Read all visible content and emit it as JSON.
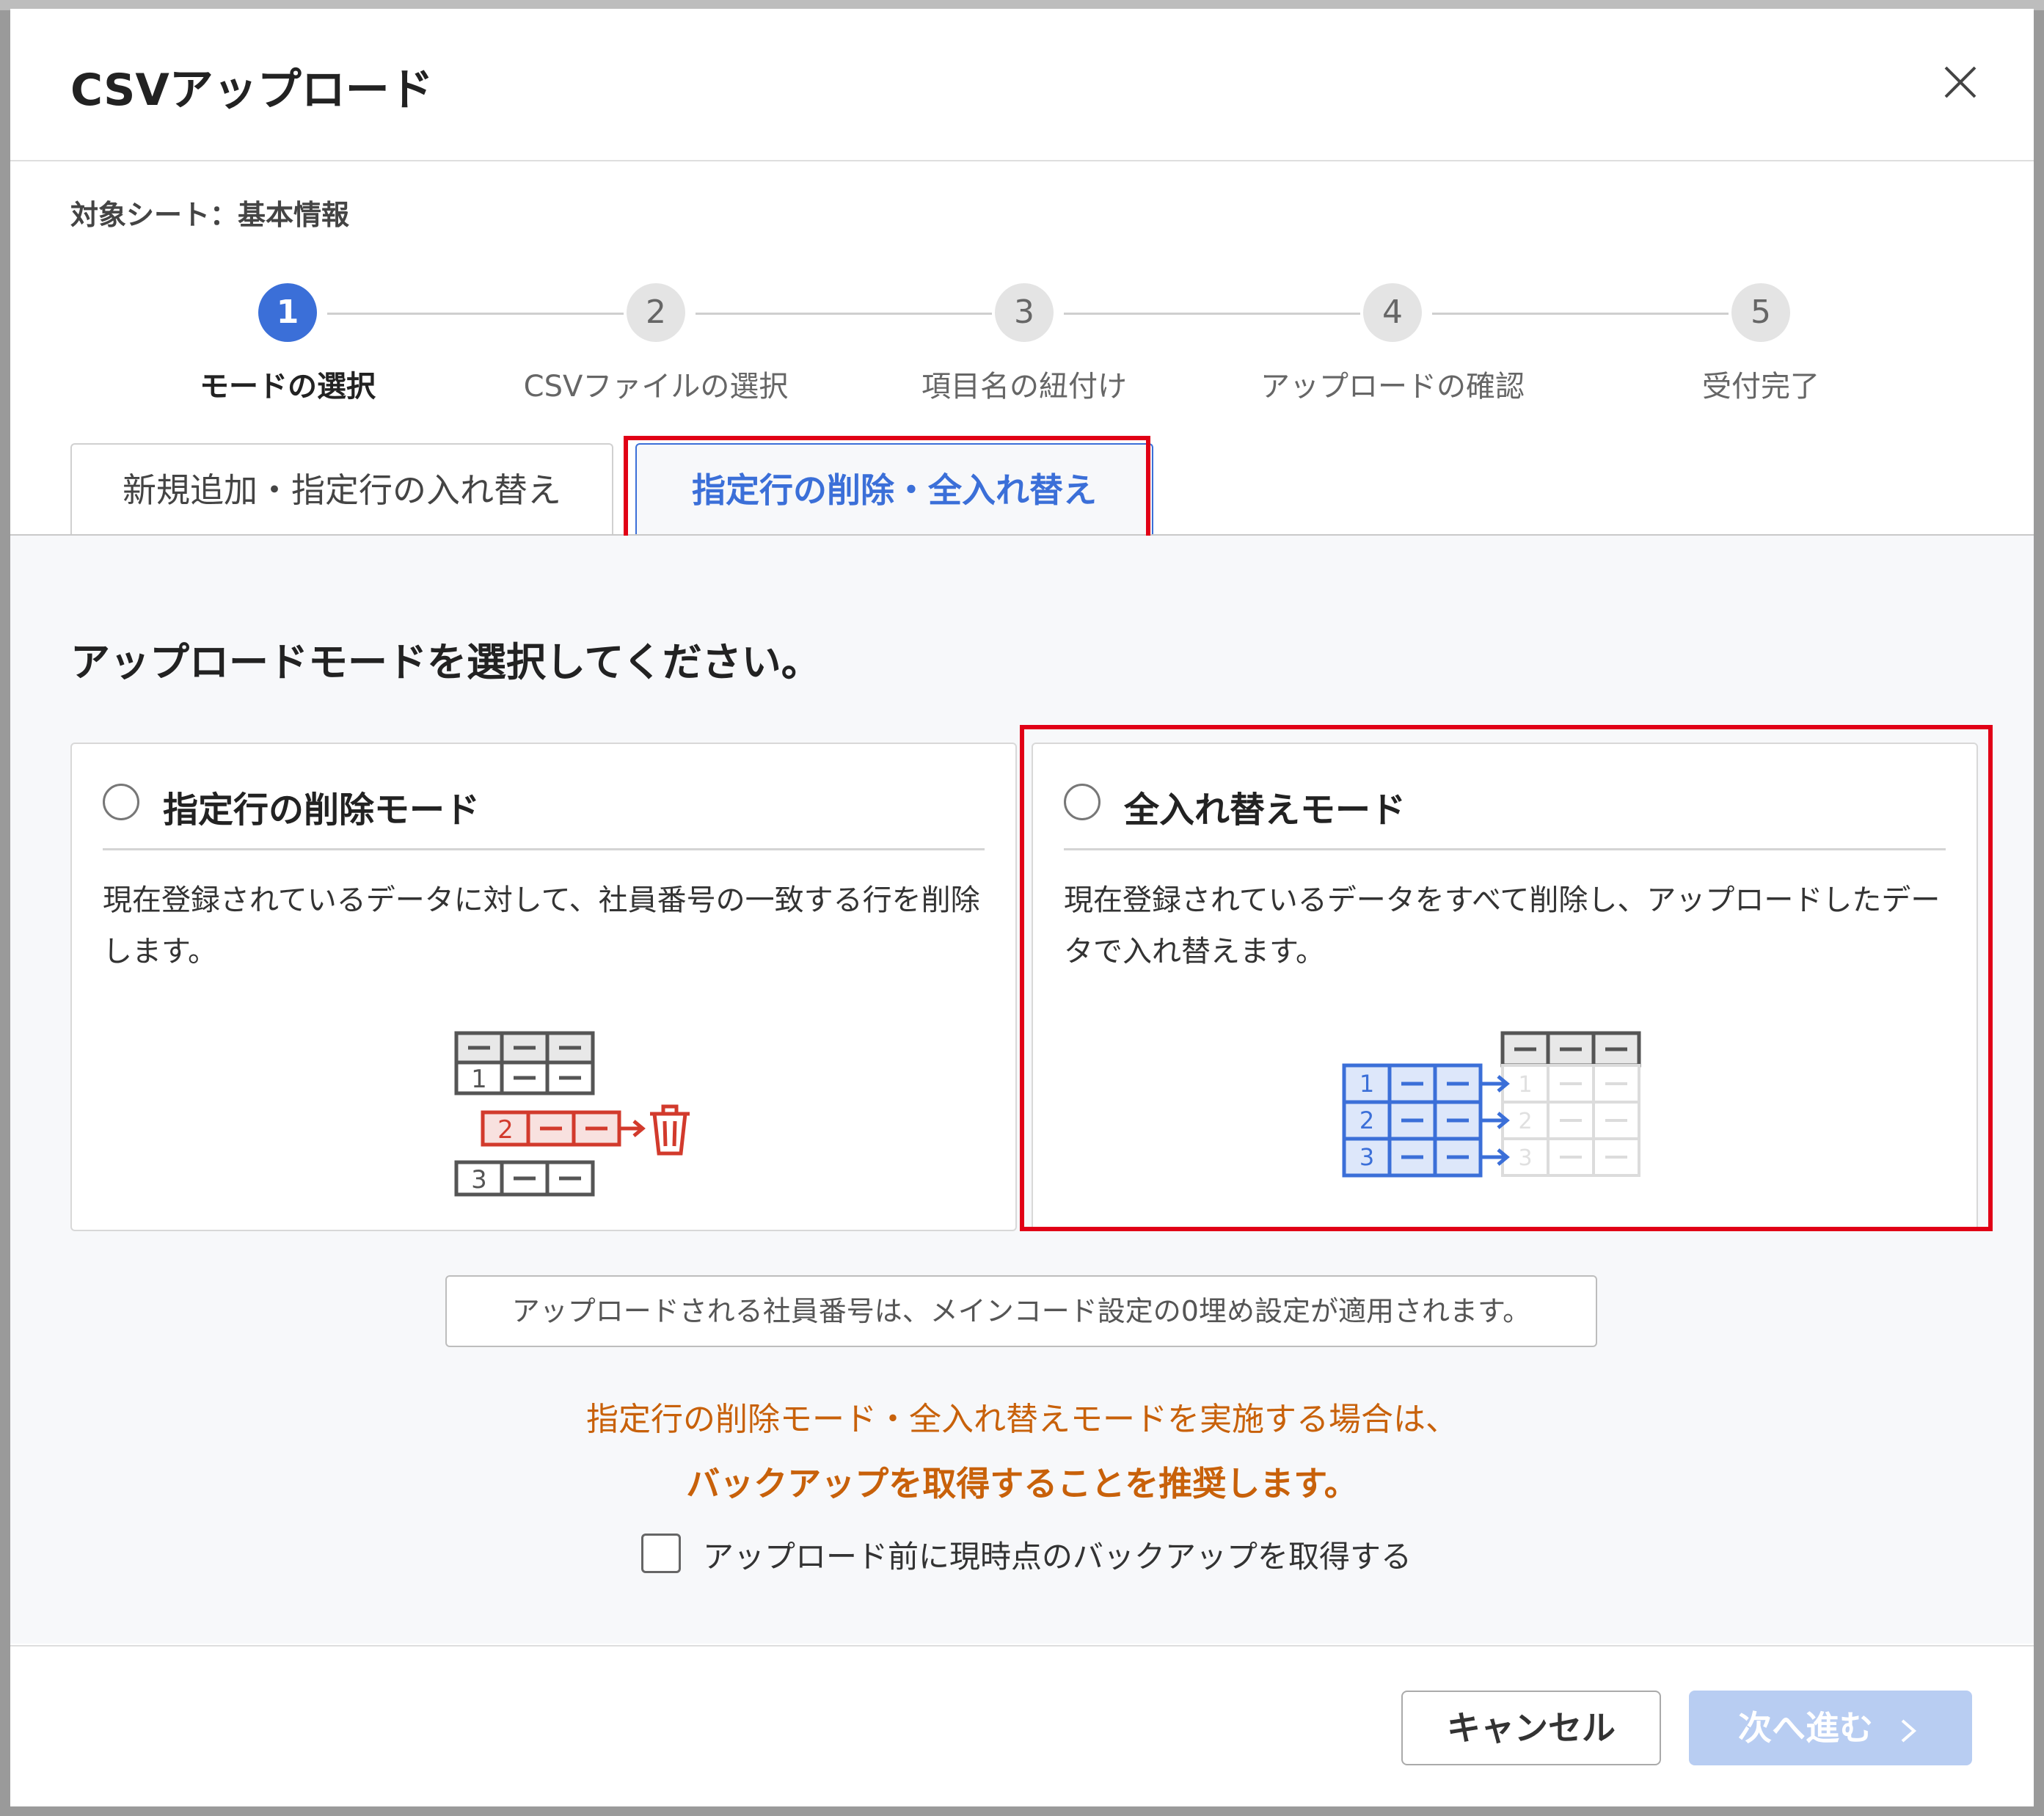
{
  "dialog": {
    "title": "CSVアップロード",
    "target_sheet": "対象シート：基本情報"
  },
  "stepper": [
    {
      "num": "1",
      "label": "モードの選択",
      "active": true
    },
    {
      "num": "2",
      "label": "CSVファイルの選択",
      "active": false
    },
    {
      "num": "3",
      "label": "項目名の紐付け",
      "active": false
    },
    {
      "num": "4",
      "label": "アップロードの確認",
      "active": false
    },
    {
      "num": "5",
      "label": "受付完了",
      "active": false
    }
  ],
  "tabs": [
    {
      "label": "新規追加・指定行の入れ替え",
      "active": false
    },
    {
      "label": "指定行の削除・全入れ替え",
      "active": true
    }
  ],
  "main": {
    "prompt": "アップロードモードを選択してください。",
    "modes": [
      {
        "title": "指定行の削除モード",
        "desc": "現在登録されているデータに対して、社員番号の一致する行を削除します。",
        "selected": false
      },
      {
        "title": "全入れ替えモード",
        "desc": "現在登録されているデータをすべて削除し、アップロードしたデータで入れ替えます。",
        "selected": false
      }
    ],
    "info": "アップロードされる社員番号は、メインコード設定の0埋め設定が適用されます。",
    "warning_line1": "指定行の削除モード・全入れ替えモードを実施する場合は、",
    "warning_line2": "バックアップを取得することを推奨します。",
    "backup_checkbox_label": "アップロード前に現時点のバックアップを取得する",
    "backup_checked": false
  },
  "illustration": {
    "delete_rows": [
      "1",
      "2",
      "3"
    ],
    "replace_rows": [
      "1",
      "2",
      "3"
    ]
  },
  "footer": {
    "cancel_label": "キャンセル",
    "next_label": "次へ進む"
  },
  "colors": {
    "accent": "#3b6fd8",
    "highlight": "#e10016",
    "warning": "#c8610a",
    "delete_red": "#d23a2c",
    "disabled_button": "#b8cdf2"
  },
  "icons": [
    "close-icon",
    "trash-icon",
    "arrow-right-icon",
    "chevron-right-icon",
    "radio-icon",
    "checkbox-icon"
  ]
}
